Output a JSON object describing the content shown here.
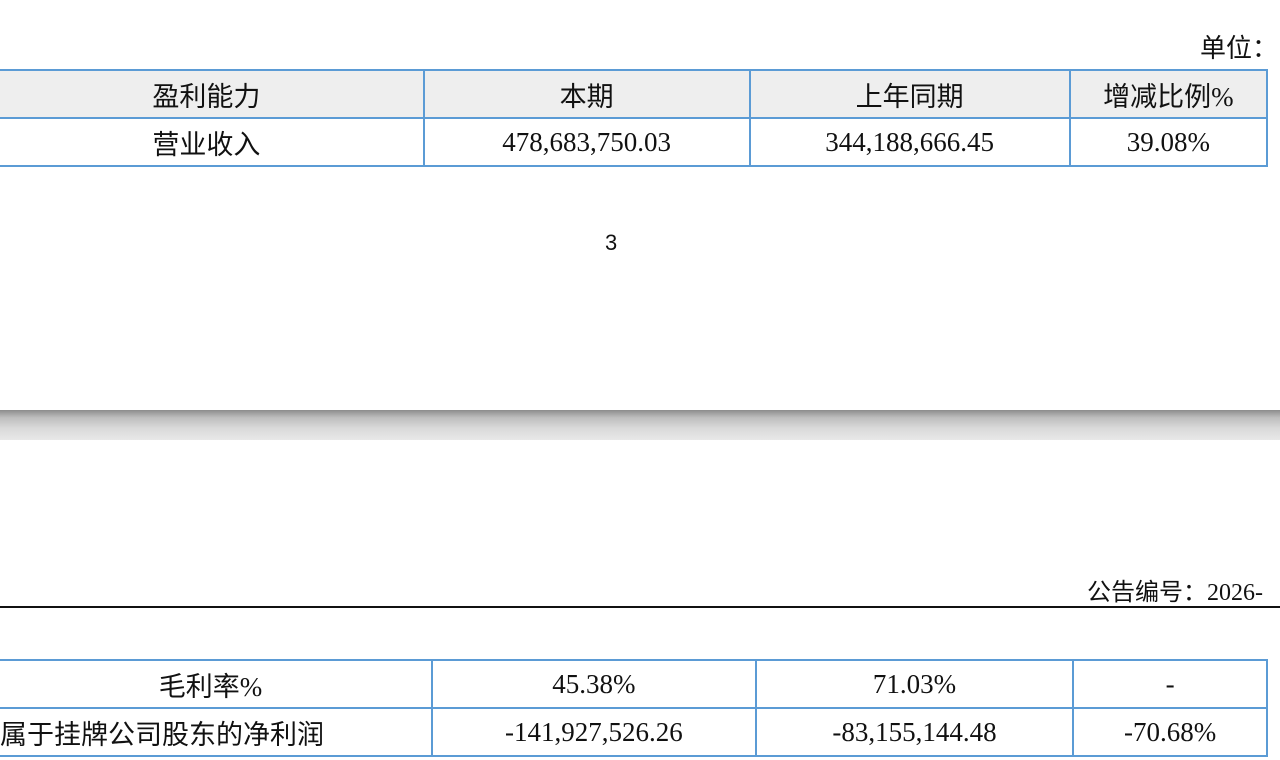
{
  "top_page": {
    "unit_label": "单位：",
    "table": {
      "headers": [
        "盈利能力",
        "本期",
        "上年同期",
        "增减比例%"
      ],
      "rows": [
        [
          "营业收入",
          "478,683,750.03",
          "344,188,666.45",
          "39.08%"
        ]
      ]
    },
    "page_number": "3"
  },
  "bottom_page": {
    "notice_number": "公告编号：2026-",
    "table": {
      "rows": [
        [
          "毛利率%",
          "45.38%",
          "71.03%",
          "-"
        ],
        [
          "属于挂牌公司股东的净利润",
          "-141,927,526.26",
          "-83,155,144.48",
          "-70.68%"
        ]
      ]
    }
  }
}
